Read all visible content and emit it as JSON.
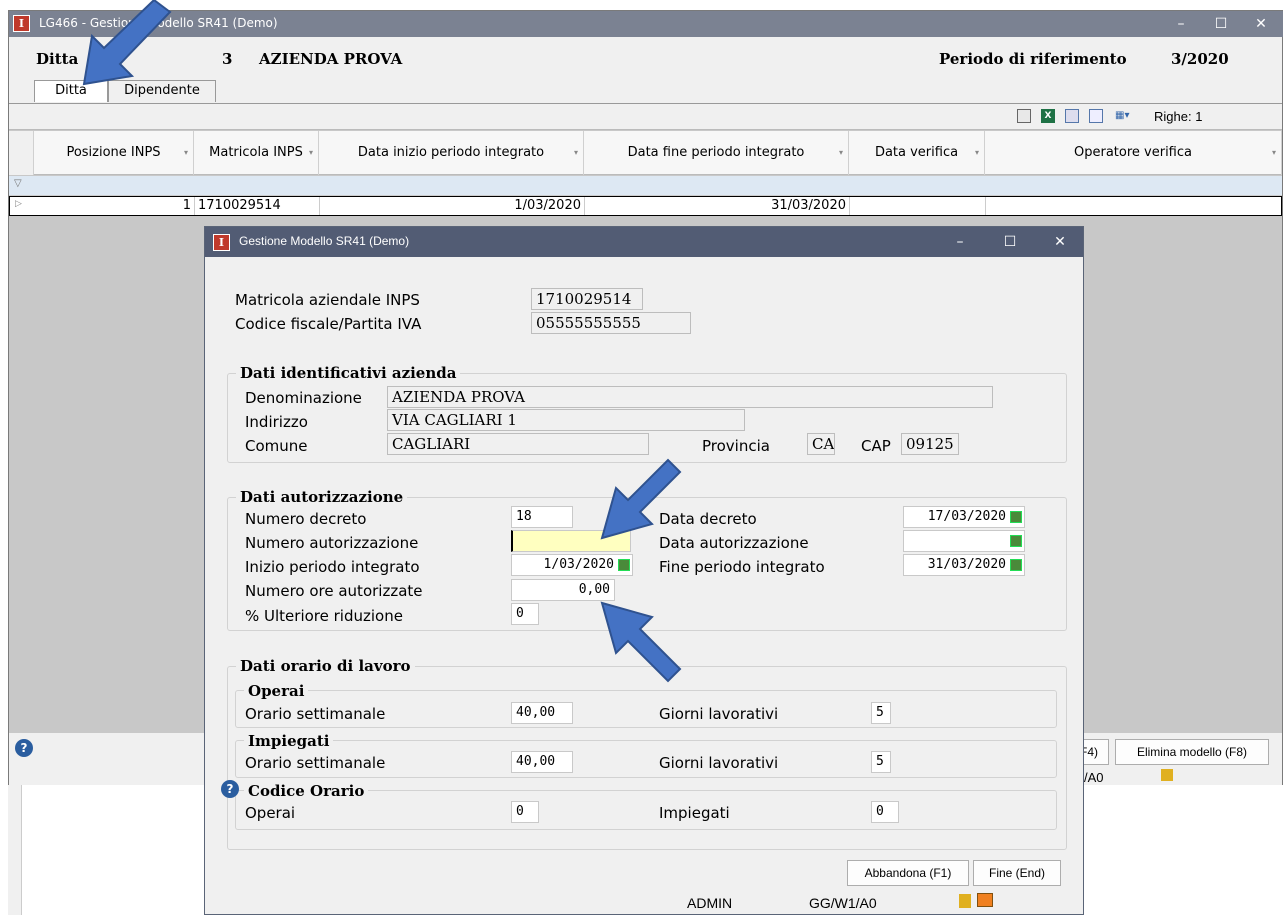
{
  "bg_window": {
    "title": "LG466 - Gestione Modello SR41 (Demo)",
    "controls": {
      "minimize": "–",
      "maximize": "☐",
      "close": "✕"
    },
    "ditta_label": "Ditta",
    "ditta_code": "3",
    "ditta_name": "AZIENDA PROVA",
    "periodo_label": "Periodo di riferimento",
    "periodo_value": "3/2020",
    "tabs": [
      "Ditta",
      "Dipendente"
    ],
    "toolbar": {
      "righe": "Righe: 1"
    },
    "columns": [
      "Posizione INPS",
      "Matricola INPS",
      "Data inizio periodo integrato",
      "Data fine periodo integrato",
      "Data verifica",
      "Operatore verifica"
    ],
    "rows": [
      {
        "posizione": "1",
        "matricola": "1710029514",
        "data_inizio": "1/03/2020",
        "data_fine": "31/03/2020",
        "data_verifica": "",
        "operatore": ""
      }
    ],
    "footer": {
      "partial_button": "F4)",
      "delete_button": "Elimina modello (F8)",
      "status_partial": "/A0"
    }
  },
  "dialog": {
    "title": "Gestione Modello SR41 (Demo)",
    "controls": {
      "minimize": "–",
      "maximize": "☐",
      "close": "✕"
    },
    "matricola_label": "Matricola aziendale INPS",
    "matricola_value": "1710029514",
    "cf_label": "Codice fiscale/Partita IVA",
    "cf_value": "05555555555",
    "group_azienda": {
      "title": "Dati identificativi azienda",
      "denominazione_label": "Denominazione",
      "denominazione_value": "AZIENDA PROVA",
      "indirizzo_label": "Indirizzo",
      "indirizzo_value": "VIA CAGLIARI 1",
      "comune_label": "Comune",
      "comune_value": "CAGLIARI",
      "provincia_label": "Provincia",
      "provincia_value": "CA",
      "cap_label": "CAP",
      "cap_value": "09125"
    },
    "group_autorizzazione": {
      "title": "Dati autorizzazione",
      "numero_decreto_label": "Numero decreto",
      "numero_decreto_value": "18",
      "numero_autorizzazione_label": "Numero autorizzazione",
      "numero_autorizzazione_value": "",
      "inizio_label": "Inizio periodo integrato",
      "inizio_value": "1/03/2020",
      "ore_label": "Numero ore autorizzate",
      "ore_value": "0,00",
      "riduzione_label": "% Ulteriore riduzione",
      "riduzione_value": "0",
      "data_decreto_label": "Data decreto",
      "data_decreto_value": "17/03/2020",
      "data_autorizzazione_label": "Data autorizzazione",
      "data_autorizzazione_value": "",
      "fine_label": "Fine periodo integrato",
      "fine_value": "31/03/2020"
    },
    "group_orario": {
      "title": "Dati orario di lavoro",
      "operai_title": "Operai",
      "operai_orario_label": "Orario settimanale",
      "operai_orario_value": "40,00",
      "operai_giorni_label": "Giorni lavorativi",
      "operai_giorni_value": "5",
      "impiegati_title": "Impiegati",
      "impiegati_orario_label": "Orario settimanale",
      "impiegati_orario_value": "40,00",
      "impiegati_giorni_label": "Giorni lavorativi",
      "impiegati_giorni_value": "5",
      "codice_title": "Codice Orario",
      "codice_operai_label": "Operai",
      "codice_operai_value": "0",
      "codice_impiegati_label": "Impiegati",
      "codice_impiegati_value": "0"
    },
    "abbandona_button": "Abbandona (F1)",
    "fine_button": "Fine (End)",
    "status_user": "ADMIN",
    "status_code": "GG/W1/A0"
  },
  "colors": {
    "arrow": "#4472c4",
    "highlight_field": "#ffffc0",
    "titlebar_bg": "#7b8292",
    "dialog_titlebar": "#525c74"
  }
}
